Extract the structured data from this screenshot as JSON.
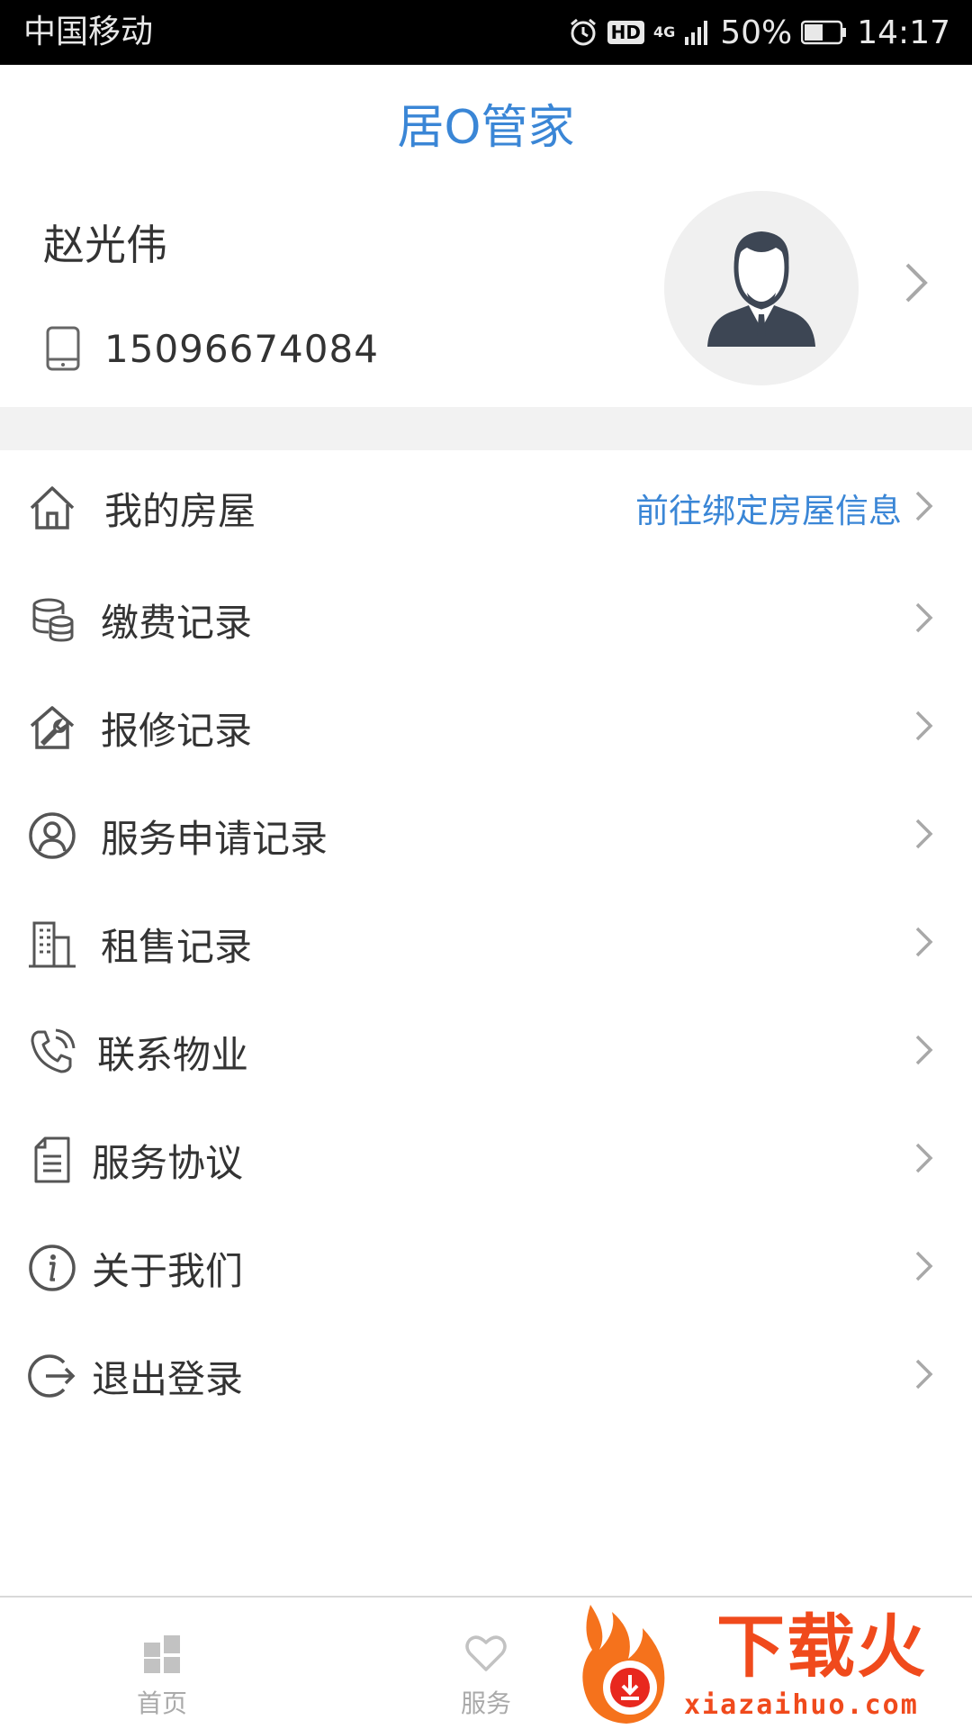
{
  "status_bar": {
    "carrier": "中国移动",
    "hd": "HD",
    "network": "4G",
    "battery": "50%",
    "time": "14:17"
  },
  "header": {
    "title": "居O管家"
  },
  "profile": {
    "name": "赵光伟",
    "phone": "15096674084"
  },
  "menu": [
    {
      "label": "我的房屋",
      "hint": "前往绑定房屋信息",
      "icon": "house-icon"
    },
    {
      "label": "缴费记录",
      "icon": "coins-icon"
    },
    {
      "label": "报修记录",
      "icon": "repair-house-icon"
    },
    {
      "label": "服务申请记录",
      "icon": "user-circle-icon"
    },
    {
      "label": "租售记录",
      "icon": "building-icon"
    },
    {
      "label": "联系物业",
      "icon": "phone-icon"
    },
    {
      "label": "服务协议",
      "icon": "document-icon"
    },
    {
      "label": "关于我们",
      "icon": "info-icon"
    },
    {
      "label": "退出登录",
      "icon": "logout-icon"
    }
  ],
  "bottom_nav": [
    {
      "label": "首页",
      "icon": "grid-icon"
    },
    {
      "label": "服务",
      "icon": "heart-icon"
    }
  ],
  "watermark": {
    "text": "下载火",
    "domain": "xiazaihuo.com"
  },
  "colors": {
    "accent": "#3a86d6",
    "watermark": "#f04a1c"
  }
}
